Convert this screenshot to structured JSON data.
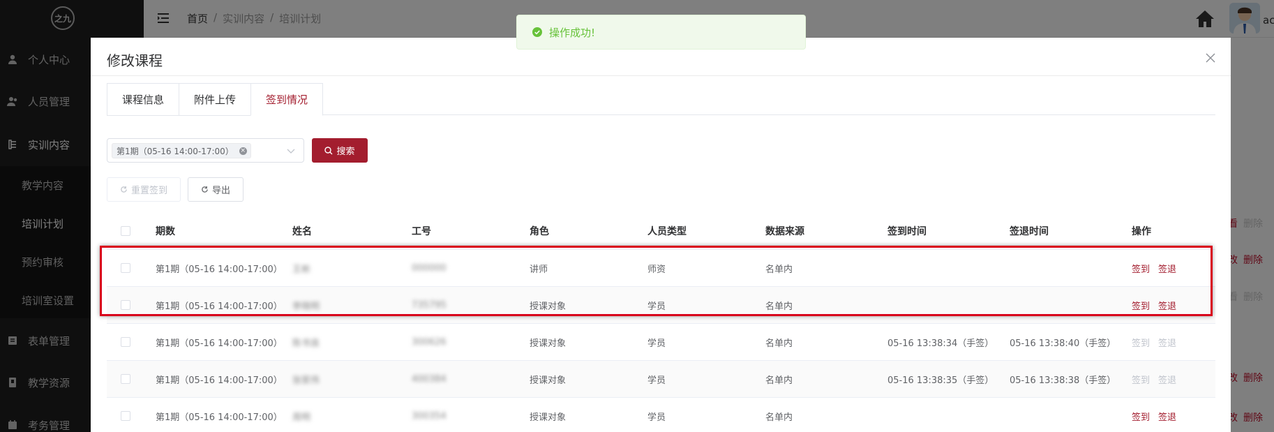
{
  "sidebar": {
    "logo": "之九",
    "items": [
      {
        "label": "个人中心",
        "icon": "user-icon"
      },
      {
        "label": "人员管理",
        "icon": "users-icon"
      },
      {
        "label": "实训内容",
        "icon": "book-icon"
      },
      {
        "label": "表单管理",
        "icon": "form-icon"
      },
      {
        "label": "教学资源",
        "icon": "resource-icon"
      },
      {
        "label": "考务管理",
        "icon": "exam-icon"
      }
    ],
    "sub_items": [
      {
        "label": "教学内容"
      },
      {
        "label": "培训计划"
      },
      {
        "label": "预约审核"
      },
      {
        "label": "培训室设置"
      }
    ]
  },
  "header": {
    "breadcrumb": [
      "首页",
      "/",
      "实训内容",
      "/",
      "培训计划"
    ],
    "username": "ac"
  },
  "background_actions": {
    "edit_partial": "看",
    "delete_label": "删除",
    "edit_partial2": "改"
  },
  "toast": {
    "message": "操作成功!"
  },
  "dialog": {
    "title": "修改课程",
    "tabs": [
      {
        "label": "课程信息",
        "active": false
      },
      {
        "label": "附件上传",
        "active": false
      },
      {
        "label": "签到情况",
        "active": true
      }
    ],
    "filter": {
      "tag_label": "第1期（05-16 14:00-17:00）"
    },
    "search_label": "搜索",
    "reset_label": "重置签到",
    "export_label": "导出",
    "table": {
      "columns": [
        "期数",
        "姓名",
        "工号",
        "角色",
        "人员类型",
        "数据来源",
        "签到时间",
        "签退时间",
        "操作"
      ],
      "rows": [
        {
          "period": "第1期（05-16 14:00-17:00）",
          "name": "王彬",
          "id": "000000",
          "role": "讲师",
          "ptype": "师资",
          "source": "名单内",
          "checkin": "",
          "checkout": "",
          "ops_enabled": true
        },
        {
          "period": "第1期（05-16 14:00-17:00）",
          "name": "李晓明",
          "id": "735795",
          "role": "授课对象",
          "ptype": "学员",
          "source": "名单内",
          "checkin": "",
          "checkout": "",
          "ops_enabled": true
        },
        {
          "period": "第1期（05-16 14:00-17:00）",
          "name": "陈书良",
          "id": "300626",
          "role": "授课对象",
          "ptype": "学员",
          "source": "名单内",
          "checkin": "05-16 13:38:34（手签）",
          "checkout": "05-16 13:38:40（手签）",
          "ops_enabled": false
        },
        {
          "period": "第1期（05-16 14:00-17:00）",
          "name": "张家伟",
          "id": "400384",
          "role": "授课对象",
          "ptype": "学员",
          "source": "名单内",
          "checkin": "05-16 13:38:35（手签）",
          "checkout": "05-16 13:38:38（手签）",
          "ops_enabled": false
        },
        {
          "period": "第1期（05-16 14:00-17:00）",
          "name": "周明",
          "id": "300354",
          "role": "授课对象",
          "ptype": "学员",
          "source": "名单内",
          "checkin": "",
          "checkout": "",
          "ops_enabled": true
        }
      ],
      "op_checkin": "签到",
      "op_checkout": "签退"
    }
  },
  "colors": {
    "brand": "#a31d2e",
    "success": "#67c23a",
    "highlight": "#d9001b"
  }
}
